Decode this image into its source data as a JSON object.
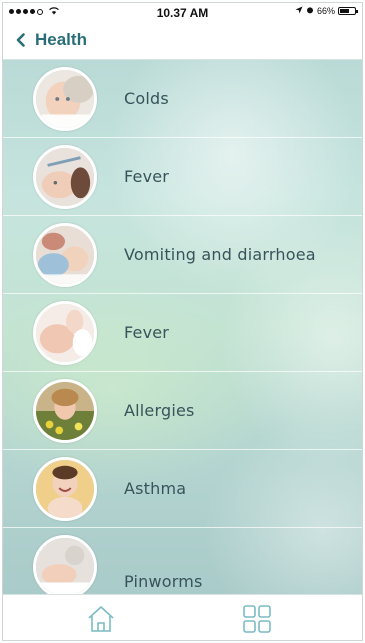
{
  "status": {
    "time": "10.37 AM",
    "battery": "66%",
    "battery_level": 0.66
  },
  "nav": {
    "back_icon": "chevron-left-icon",
    "title": "Health"
  },
  "items": [
    {
      "label": "Colds",
      "image": "baby-photo"
    },
    {
      "label": "Fever",
      "image": "baby-thermometer-photo"
    },
    {
      "label": "Vomiting and diarrhoea",
      "image": "baby-being-fed-photo"
    },
    {
      "label": "Fever",
      "image": "baby-hands-photo"
    },
    {
      "label": "Allergies",
      "image": "child-flowers-photo"
    },
    {
      "label": "Asthma",
      "image": "toddler-smiling-photo"
    },
    {
      "label": "Pinworms",
      "image": "baby-sleeping-photo"
    }
  ],
  "tabs": [
    {
      "icon": "home-icon"
    },
    {
      "icon": "grid-icon"
    }
  ],
  "colors": {
    "accent": "#2a6e78",
    "label": "#38545a",
    "tab_icon": "#7bbcc4"
  }
}
